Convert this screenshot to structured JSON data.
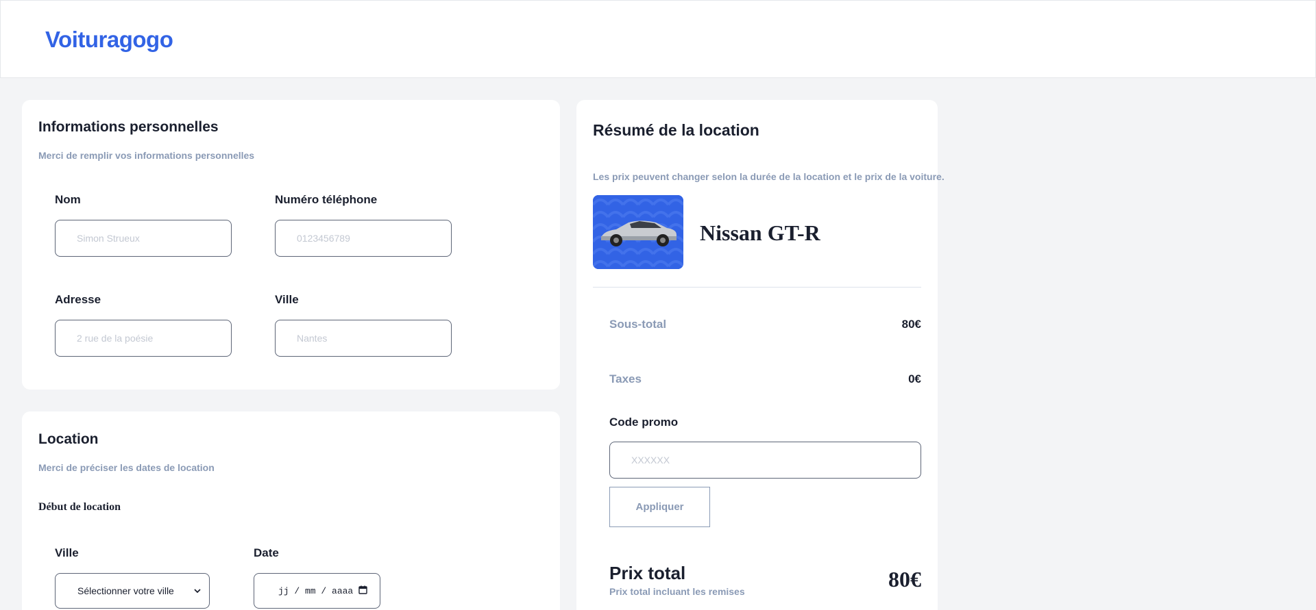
{
  "header": {
    "brand": "Voituragogo"
  },
  "personal": {
    "title": "Informations personnelles",
    "subtitle": "Merci de remplir vos informations personnelles",
    "fields": {
      "nom": {
        "label": "Nom",
        "placeholder": "Simon Strueux",
        "value": ""
      },
      "phone": {
        "label": "Numéro téléphone",
        "placeholder": "0123456789",
        "value": ""
      },
      "adresse": {
        "label": "Adresse",
        "placeholder": "2 rue de la poésie",
        "value": ""
      },
      "ville": {
        "label": "Ville",
        "placeholder": "Nantes",
        "value": ""
      }
    }
  },
  "location": {
    "title": "Location",
    "subtitle": "Merci de préciser les dates de location",
    "start_label": "Début de location",
    "ville_label": "Ville",
    "ville_select": "Sélectionner votre ville",
    "date_label": "Date",
    "date_placeholder": "jj / mm / aaaa"
  },
  "summary": {
    "title": "Résumé de la location",
    "note": "Les prix peuvent changer selon la durée de la location et le prix de la voiture.",
    "car_name": "Nissan GT-R",
    "subtotal_label": "Sous-total",
    "subtotal_value": "80€",
    "taxes_label": "Taxes",
    "taxes_value": "0€",
    "promo_label": "Code promo",
    "promo_placeholder": "XXXXXX",
    "apply_label": "Appliquer",
    "total_label": "Prix total",
    "total_sub": "Prix total incluant les remises",
    "total_value": "80€"
  },
  "icons": {
    "select": "chevron-down-icon",
    "date": "calendar-icon",
    "car": "car-photo"
  },
  "colors": {
    "brand": "#3263e5",
    "muted": "#8a9ab5",
    "text": "#1a1f2e",
    "background": "#f3f4f6"
  }
}
